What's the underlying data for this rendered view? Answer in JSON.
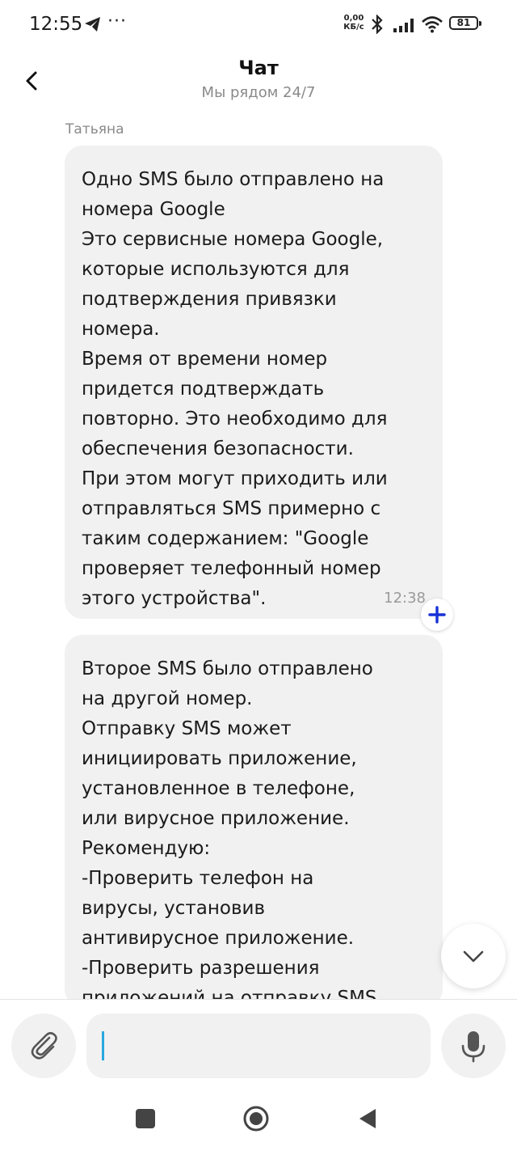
{
  "status_bar": {
    "time": "12:55",
    "dots": "···",
    "net_speed_value": "0,00",
    "net_speed_unit": "КБ/с",
    "battery": "81"
  },
  "header": {
    "title": "Чат",
    "subtitle": "Мы рядом 24/7"
  },
  "chat": {
    "sender": "Татьяна",
    "messages": [
      {
        "text": "Одно SMS было отправлено на\nномера Google\nЭто сервисные номера Google,\nкоторые используются для\nподтверждения привязки\nномера.\nВремя от времени номер\nпридется подтверждать\nповторно. Это необходимо для\nобеспечения безопасности.\nПри этом могут приходить или\nотправляться SMS примерно с\nтаким содержанием: \"Google\nпроверяет телефонный номер\nэтого устройства\".",
        "time": "12:38"
      },
      {
        "text": "Второе SMS было отправлено\nна другой номер.\nОтправку SMS может\nинициировать приложение,\nустановленное в телефоне,\nили вирусное приложение.\nРекомендую:\n-Проверить телефон на\nвирусы, установив\nантивирусное приложение.\n-Проверить разрешения\nприложений на отправку SMS",
        "time": ""
      }
    ]
  },
  "composer": {
    "input_value": ""
  },
  "colors": {
    "accent": "#1631d6",
    "bubble_bg": "#f1f1f1",
    "caret": "#29a8e0"
  },
  "icons": {
    "back": "chevron-left-icon",
    "reaction": "plus-icon",
    "scroll_down": "chevron-down-icon",
    "attach": "paperclip-icon",
    "mic": "microphone-icon"
  }
}
